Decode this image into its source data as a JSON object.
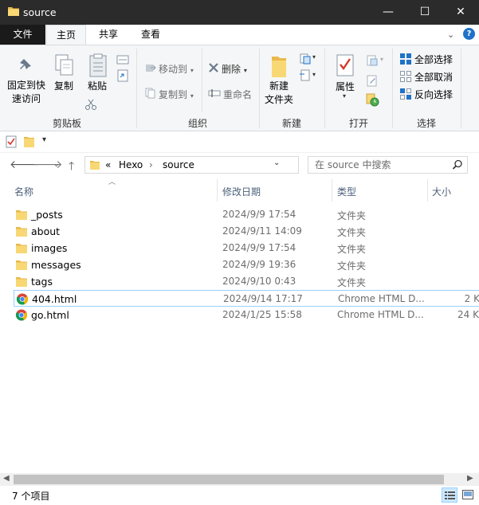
{
  "window": {
    "title": "source",
    "minimize": "—",
    "maximize": "☐",
    "close": "✕"
  },
  "ribbon_tabs": [
    {
      "label": "文件"
    },
    {
      "label": "主页"
    },
    {
      "label": "共享"
    },
    {
      "label": "查看"
    }
  ],
  "ribbon": {
    "clipboard": {
      "group_label": "剪贴板",
      "pin_label_1": "固定到快",
      "pin_label_2": "速访问",
      "copy_label": "复制",
      "paste_label": "粘贴"
    },
    "organize": {
      "group_label": "组织",
      "move_to": "移动到",
      "copy_to": "复制到",
      "delete": "删除",
      "rename": "重命名"
    },
    "new": {
      "group_label": "新建",
      "new_folder_1": "新建",
      "new_folder_2": "文件夹"
    },
    "open": {
      "group_label": "打开",
      "properties": "属性"
    },
    "select": {
      "group_label": "选择",
      "select_all": "全部选择",
      "select_none": "全部取消",
      "invert": "反向选择"
    }
  },
  "address": {
    "overflow": "«",
    "segments": [
      "Hexo",
      "source"
    ],
    "separator": "›"
  },
  "search": {
    "placeholder": "在 source 中搜索"
  },
  "columns": {
    "name": "名称",
    "date": "修改日期",
    "type": "类型",
    "size": "大小"
  },
  "files": [
    {
      "name": "_posts",
      "date": "2024/9/9 17:54",
      "type": "文件夹",
      "size": "",
      "icon": "folder-icon"
    },
    {
      "name": "about",
      "date": "2024/9/11 14:09",
      "type": "文件夹",
      "size": "",
      "icon": "folder-icon"
    },
    {
      "name": "images",
      "date": "2024/9/9 17:54",
      "type": "文件夹",
      "size": "",
      "icon": "folder-icon"
    },
    {
      "name": "messages",
      "date": "2024/9/9 19:36",
      "type": "文件夹",
      "size": "",
      "icon": "folder-icon"
    },
    {
      "name": "tags",
      "date": "2024/9/10 0:43",
      "type": "文件夹",
      "size": "",
      "icon": "folder-icon"
    },
    {
      "name": "404.html",
      "date": "2024/9/14 17:17",
      "type": "Chrome HTML D...",
      "size": "2 K",
      "icon": "chrome-icon"
    },
    {
      "name": "go.html",
      "date": "2024/1/25 15:58",
      "type": "Chrome HTML D...",
      "size": "24 K",
      "icon": "chrome-icon"
    }
  ],
  "status": {
    "count": "7 个项目"
  },
  "colors": {
    "folder": "#f8d775",
    "accent": "#1e72c8",
    "selection_border": "#99d1ff"
  }
}
